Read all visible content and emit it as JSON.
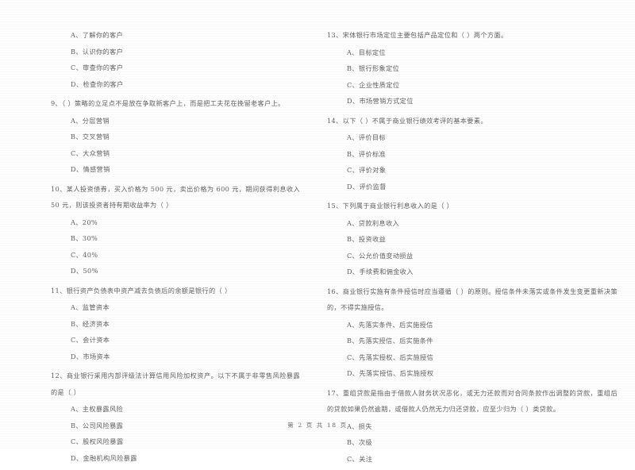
{
  "document": {
    "page_footer": "第 2 页  共 18 页",
    "page_number": "2",
    "total_pages": "18"
  },
  "left_column": {
    "questions": [
      {
        "stem": "",
        "options": [
          "A、了解你的客户",
          "B、认识你的客户",
          "C、审查你的客户",
          "D、检查你的客户"
        ]
      },
      {
        "stem": "9、（     ）策略的立足点不是放在争取新客户上，而是把工夫花在挽留老客户上。",
        "options": [
          "A、分层营销",
          "B、交叉营销",
          "C、大众营销",
          "D、情感营销"
        ]
      },
      {
        "stem": "10、某人投资债券，买入价格为 500 元，卖出价格为 600 元，期间获得利息收入 50 元，则该投资者持有期收益率为（     ）",
        "options": [
          "A、20%",
          "B、30%",
          "C、40%",
          "D、50%"
        ]
      },
      {
        "stem": "11、银行资产负债表中资产减去负债后的余额是银行的（     ）",
        "options": [
          "A、监管资本",
          "B、经济资本",
          "C、会计资本",
          "D、市场资本"
        ]
      },
      {
        "stem": "12、商业银行采用内部评级法计算信用风险加权资产。以下不属于非零售风险暴露的是（     ）",
        "options": [
          "A、主权暴露风险",
          "B、公司风险暴露",
          "C、股权风险暴露",
          "D、金融机构风险暴露"
        ]
      }
    ]
  },
  "right_column": {
    "questions": [
      {
        "stem": "13、宋体银行市场定位主要包括产品定位和（     ）两个方面。",
        "options": [
          "A、目标定位",
          "B、银行形象定位",
          "C、企业性质定位",
          "D、市场营销方式定位"
        ]
      },
      {
        "stem": "14、以下（     ）不属于商业银行绩效考评的基本要素。",
        "options": [
          "A、评价目标",
          "B、评价标准",
          "C、评价对象",
          "D、评价监督"
        ]
      },
      {
        "stem": "15、下列属于商业银行利息收入的是（     ）",
        "options": [
          "A、贷款利息收入",
          "B、投资收益",
          "C、公允价值变动损益",
          "D、手续费和佣金收入"
        ]
      },
      {
        "stem": "16、商业银行实施有条件授信时应当遵循（     ）的原则。授信条件未落实或条件发生变更重新决策的，不得实施授信。",
        "options": [
          "A、先落实条件、后实施授信",
          "B、先落实授信、后实施条件",
          "C、先落实授权、后实施授信",
          "D、先落实授信、后实施授权"
        ]
      },
      {
        "stem": "17、重组贷款是指由于借款人财务状况恶化，或无力还款而对合同条款作出调整的贷款，重组后的贷款如果仍然逾期，或借款人仍然无力归还贷款，应至少归为（     ）类贷款。",
        "options": [
          "A、损失",
          "B、次级",
          "C、关注"
        ]
      }
    ]
  }
}
